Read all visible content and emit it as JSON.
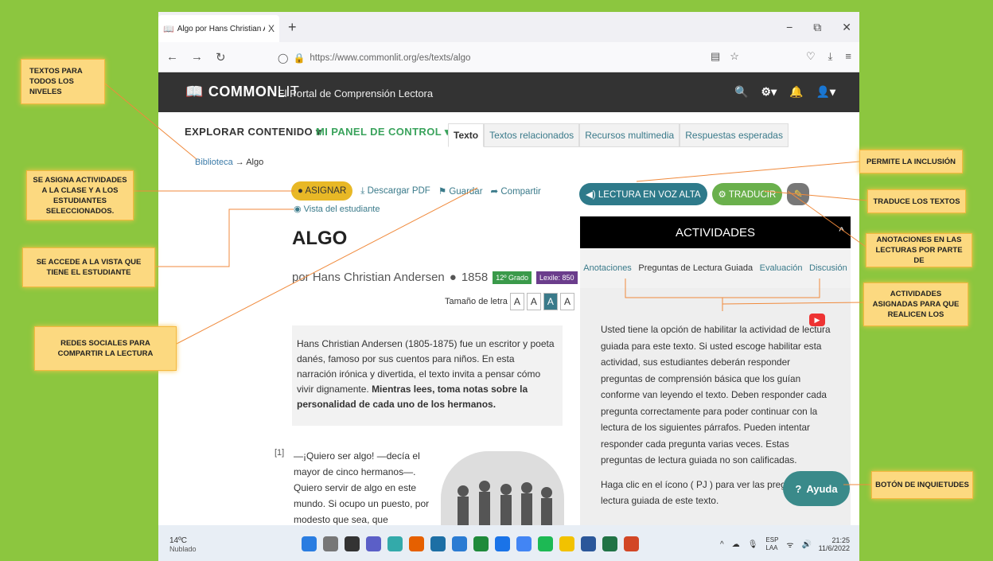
{
  "browser": {
    "tab_title": "Algo por Hans Christian Anders",
    "tab_close": "X",
    "new_tab": "+",
    "url": "https://www.commonlit.org/es/texts/algo"
  },
  "site": {
    "logo_bold": "COMMON",
    "logo_light": "LIT",
    "slogan": "El Portal de Comprensión Lectora"
  },
  "nav": {
    "explorar": "EXPLORAR CONTENIDO ▾",
    "panel": "MI PANEL DE CONTROL ▾",
    "tabs": [
      "Texto",
      "Textos relacionados",
      "Recursos multimedia",
      "Respuestas esperadas"
    ]
  },
  "breadcrumb": {
    "library": "Biblioteca",
    "arrow": "→",
    "current": "Algo"
  },
  "actions": {
    "asignar": "ASIGNAR",
    "pdf": "Descargar PDF",
    "guardar": "Guardar",
    "compartir": "Compartir",
    "vista": "Vista del estudiante"
  },
  "text": {
    "title": "ALGO",
    "author": "por Hans Christian Andersen",
    "year": "1858",
    "grade": "12º Grado",
    "lexile": "Lexile: 850",
    "font_label": "Tamaño de letra",
    "font_sizes": [
      "A",
      "A",
      "A",
      "A"
    ],
    "intro_normal": "Hans Christian Andersen (1805-1875) fue un escritor y poeta danés, famoso por sus cuentos para niños. En esta narración irónica y divertida, el texto invita a pensar cómo vivir dignamente.",
    "intro_bold": "Mientras lees, toma notas sobre la personalidad de cada uno de los hermanos.",
    "para_num": "[1]",
    "para_text": "—¡Quiero ser algo! —decía el mayor de cinco hermanos—. Quiero servir de algo en este mundo. Si ocupo un puesto, por modesto que sea, que"
  },
  "right": {
    "lectura": "LECTURA EN VOZ ALTA",
    "traducir": "TRADUCIR",
    "actividades": "ACTIVIDADES",
    "tabs": [
      "Anotaciones",
      "Preguntas de Lectura Guiada",
      "Evaluación",
      "Discusión"
    ],
    "body1": "Usted tiene la opción de habilitar la actividad de lectura guiada para este texto. Si usted escoge habilitar esta actividad, sus estudiantes deberán responder preguntas de comprensión básica que los guían conforme van leyendo el texto. Deben responder cada pregunta correctamente para poder continuar con la lectura de los siguientes párrafos. Pueden intentar responder cada pregunta varias veces. Estas preguntas de lectura guiada no son calificadas.",
    "body2": "Haga clic en el ícono ( PJ ) para ver las preguntas de lectura guiada de este texto.",
    "ayuda": "Ayuda"
  },
  "taskbar": {
    "temp": "14ºC",
    "weather": "Nublado",
    "lang1": "ESP",
    "lang2": "LAA",
    "time": "21:25",
    "date": "11/6/2022"
  },
  "notes": {
    "n1": "TEXTOS PARA TODOS LOS NIVELES",
    "n2": "SE ASIGNA ACTIVIDADES A LA CLASE Y A LOS ESTUDIANTES SELECCIONADOS.",
    "n3": "SE ACCEDE A LA VISTA QUE TIENE EL ESTUDIANTE",
    "n4": "REDES SOCIALES PARA COMPARTIR LA LECTURA",
    "n5": "PERMITE LA INCLUSIÓN",
    "n6": "TRADUCE LOS TEXTOS",
    "n7": "ANOTACIONES EN LAS LECTURAS POR PARTE DE",
    "n8": "ACTIVIDADES ASIGNADAS PARA QUE REALICEN LOS",
    "n9": "BOTÓN DE INQUIETUDES"
  }
}
